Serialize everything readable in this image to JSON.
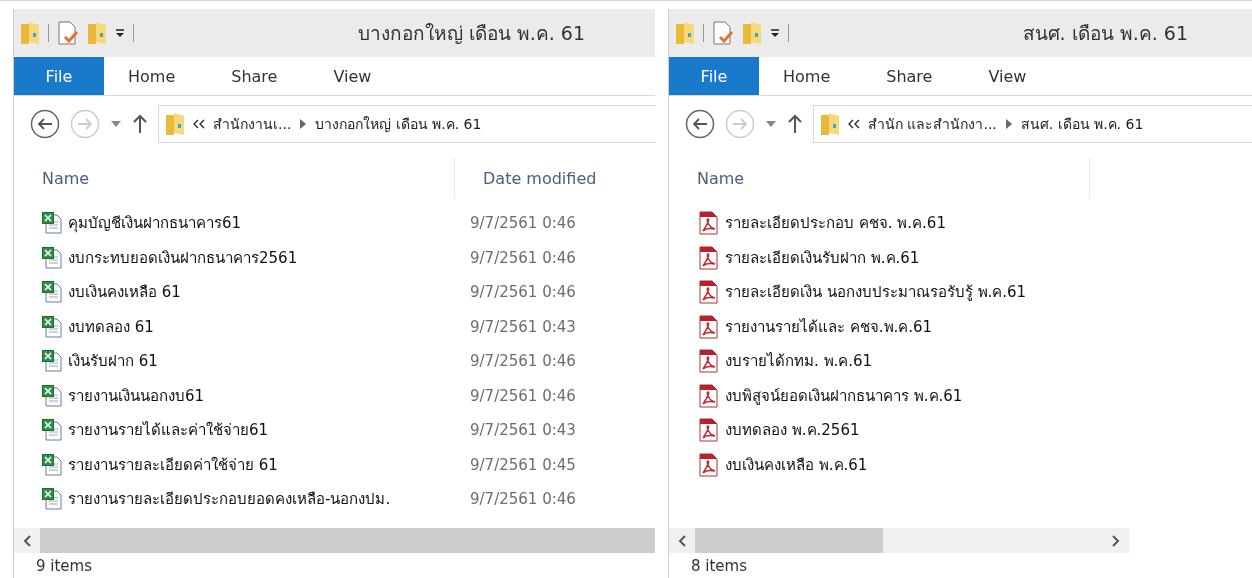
{
  "windows": [
    {
      "title": "บางกอกใหญ่ เดือน พ.ค. 61",
      "ribbon": {
        "file_button": "File",
        "tabs": [
          "Home",
          "Share",
          "View"
        ]
      },
      "breadcrumb": [
        "สำนักงานเ...",
        "บางกอกใหญ่ เดือน พ.ค. 61"
      ],
      "columns": [
        "Name",
        "Date modified"
      ],
      "files": [
        {
          "kind": "excel",
          "name": "คุมบัญชีเงินฝากธนาคาร61",
          "date": "9/7/2561 0:46"
        },
        {
          "kind": "excel",
          "name": "งบกระทบยอดเงินฝากธนาคาร2561",
          "date": "9/7/2561 0:46"
        },
        {
          "kind": "excel",
          "name": "งบเงินคงเหลือ 61",
          "date": "9/7/2561 0:46"
        },
        {
          "kind": "excel",
          "name": "งบทดลอง 61",
          "date": "9/7/2561 0:43"
        },
        {
          "kind": "excel",
          "name": "เงินรับฝาก 61",
          "date": "9/7/2561 0:46"
        },
        {
          "kind": "excel",
          "name": "รายงานเงินนอกงบ61",
          "date": "9/7/2561 0:46"
        },
        {
          "kind": "excel",
          "name": "รายงานรายได้และค่าใช้จ่าย61",
          "date": "9/7/2561 0:43"
        },
        {
          "kind": "excel",
          "name": "รายงานรายละเอียดค่าใช้จ่าย 61",
          "date": "9/7/2561 0:45"
        },
        {
          "kind": "excel",
          "name": "รายงานรายละเอียดประกอบยอดคงเหลือ-นอกงปม.",
          "date": "9/7/2561 0:46"
        }
      ],
      "status": "9 items"
    },
    {
      "title": "สนศ. เดือน พ.ค. 61",
      "ribbon": {
        "file_button": "File",
        "tabs": [
          "Home",
          "Share",
          "View"
        ]
      },
      "breadcrumb": [
        "สำนัก และสำนักงา...",
        "สนศ. เดือน พ.ค. 61"
      ],
      "columns": [
        "Name"
      ],
      "files": [
        {
          "kind": "pdf",
          "name": "รายละเอียดประกอบ คชจ. พ.ค.61"
        },
        {
          "kind": "pdf",
          "name": "รายละเอียดเงินรับฝาก พ.ค.61"
        },
        {
          "kind": "pdf",
          "name": "รายละเอียดเงิน นอกงบประมาณรอรับรู้ พ.ค.61"
        },
        {
          "kind": "pdf",
          "name": "รายงานรายได้และ คชจ.พ.ค.61"
        },
        {
          "kind": "pdf",
          "name": "งบรายได้กทม. พ.ค.61"
        },
        {
          "kind": "pdf",
          "name": "งบพิสูจน์ยอดเงินฝากธนาคาร พ.ค.61"
        },
        {
          "kind": "pdf",
          "name": "งบทดลอง พ.ค.2561"
        },
        {
          "kind": "pdf",
          "name": "งบเงินคงเหลือ พ.ค.61"
        }
      ],
      "status": "8 items"
    }
  ]
}
